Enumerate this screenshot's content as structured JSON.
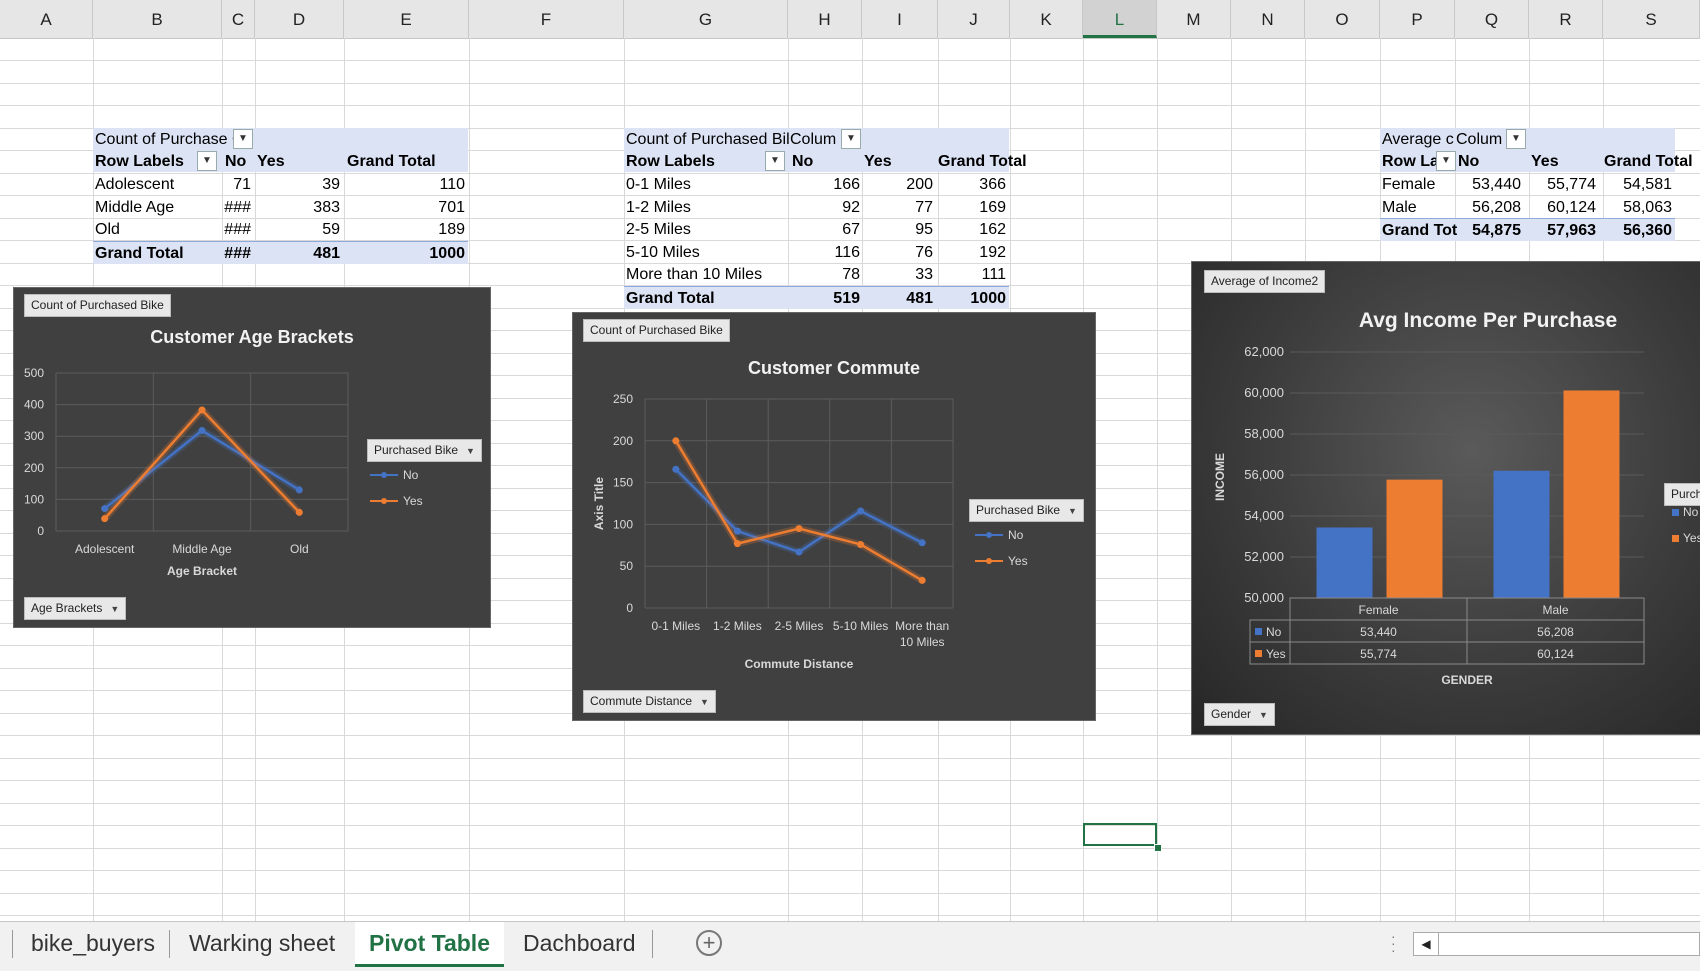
{
  "columns": [
    "A",
    "B",
    "C",
    "D",
    "E",
    "F",
    "G",
    "H",
    "I",
    "J",
    "K",
    "L",
    "M",
    "N",
    "O",
    "P",
    "Q",
    "R",
    "S"
  ],
  "selected_column": "L",
  "pivot_age": {
    "header": "Count of Purchase C",
    "col_no": "No",
    "col_yes": "Yes",
    "col_total": "Grand Total",
    "row_labels": "Row Labels",
    "rows": [
      {
        "label": "Adolescent",
        "no": "71",
        "yes": "39",
        "total": "110"
      },
      {
        "label": "Middle Age",
        "no": "###",
        "yes": "383",
        "total": "701"
      },
      {
        "label": "Old",
        "no": "###",
        "yes": "59",
        "total": "189"
      }
    ],
    "grand": {
      "label": "Grand Total",
      "no": "###",
      "yes": "481",
      "total": "1000"
    }
  },
  "pivot_commute": {
    "header": "Count of Purchased Bil",
    "col_header": "Colum",
    "row_labels": "Row Labels",
    "col_no": "No",
    "col_yes": "Yes",
    "col_total": "Grand Total",
    "rows": [
      {
        "label": "0-1 Miles",
        "no": "166",
        "yes": "200",
        "total": "366"
      },
      {
        "label": "1-2 Miles",
        "no": "92",
        "yes": "77",
        "total": "169"
      },
      {
        "label": "2-5 Miles",
        "no": "67",
        "yes": "95",
        "total": "162"
      },
      {
        "label": "5-10 Miles",
        "no": "116",
        "yes": "76",
        "total": "192"
      },
      {
        "label": "More than 10 Miles",
        "no": "78",
        "yes": "33",
        "total": "111"
      }
    ],
    "grand": {
      "label": "Grand Total",
      "no": "519",
      "yes": "481",
      "total": "1000"
    }
  },
  "pivot_income": {
    "header": "Average c",
    "col_header": "Colum",
    "row_labels": "Row La",
    "col_no": "No",
    "col_yes": "Yes",
    "col_total": "Grand Total",
    "rows": [
      {
        "label": "Female",
        "no": "53,440",
        "yes": "55,774",
        "total": "54,581"
      },
      {
        "label": "Male",
        "no": "56,208",
        "yes": "60,124",
        "total": "58,063"
      }
    ],
    "grand": {
      "label": "Grand Tot",
      "no": "54,875",
      "yes": "57,963",
      "total": "56,360"
    }
  },
  "charts": {
    "age": {
      "field_chip": "Count of Purchased Bike",
      "legend_chip": "Purchased Bike",
      "axis_chip": "Age Brackets"
    },
    "commute": {
      "field_chip": "Count of Purchased Bike",
      "legend_chip": "Purchased Bike",
      "axis_chip": "Commute Distance"
    },
    "income": {
      "field_chip": "Average of Income2",
      "legend_chip": "Purch",
      "axis_chip": "Gender"
    }
  },
  "chart_data": [
    {
      "type": "line",
      "title": "Customer Age Brackets",
      "xlabel": "Age Bracket",
      "ylabel": "",
      "categories": [
        "Adolescent",
        "Middle Age",
        "Old"
      ],
      "series": [
        {
          "name": "No",
          "values": [
            71,
            318,
            130
          ],
          "color": "#4472c4"
        },
        {
          "name": "Yes",
          "values": [
            39,
            383,
            59
          ],
          "color": "#ed7d31"
        }
      ],
      "ylim": [
        0,
        500
      ],
      "yticks": [
        "0",
        "100",
        "200",
        "300",
        "400",
        "500"
      ],
      "grid": true,
      "legend": "right"
    },
    {
      "type": "line",
      "title": "Customer Commute",
      "xlabel": "Commute Distance",
      "ylabel": "Axis Title",
      "categories": [
        "0-1 Miles",
        "1-2 Miles",
        "2-5 Miles",
        "5-10 Miles",
        "More than 10 Miles"
      ],
      "series": [
        {
          "name": "No",
          "values": [
            166,
            92,
            67,
            116,
            78
          ],
          "color": "#4472c4"
        },
        {
          "name": "Yes",
          "values": [
            200,
            77,
            95,
            76,
            33
          ],
          "color": "#ed7d31"
        }
      ],
      "ylim": [
        0,
        250
      ],
      "yticks": [
        "0",
        "50",
        "100",
        "150",
        "200",
        "250"
      ],
      "grid": true,
      "legend": "right"
    },
    {
      "type": "bar",
      "title": "Avg Income Per Purchase",
      "xlabel": "GENDER",
      "ylabel": "INCOME",
      "categories": [
        "Female",
        "Male"
      ],
      "series": [
        {
          "name": "No",
          "values": [
            53440,
            56208
          ],
          "labels": [
            "53,440",
            "56,208"
          ],
          "color": "#4472c4"
        },
        {
          "name": "Yes",
          "values": [
            55774,
            60124
          ],
          "labels": [
            "55,774",
            "60,124"
          ],
          "color": "#ed7d31"
        }
      ],
      "ylim": [
        50000,
        62000
      ],
      "yticks": [
        "50,000",
        "52,000",
        "54,000",
        "56,000",
        "58,000",
        "60,000",
        "62,000"
      ],
      "grid": true,
      "legend": "right"
    }
  ],
  "sheet_tabs": [
    "bike_buyers",
    "Warking sheet",
    "Pivot Table",
    "Dachboard"
  ],
  "active_tab": "Pivot Table"
}
